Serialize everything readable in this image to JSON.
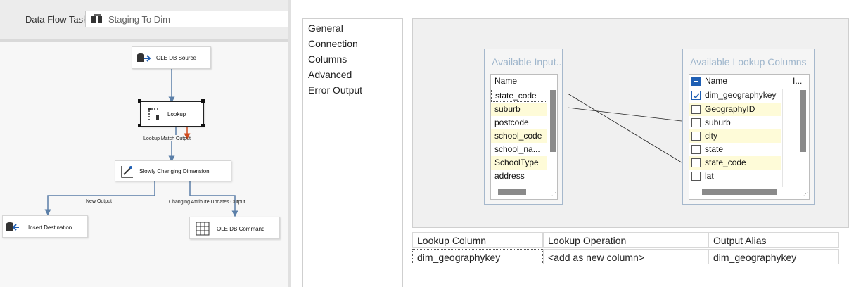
{
  "designer": {
    "task_label": "Data Flow Task:",
    "task_value": "Staging To Dim",
    "nodes": {
      "ole_db_source": "OLE DB Source",
      "lookup": "Lookup",
      "scd": "Slowly Changing Dimension",
      "insert_destination": "Insert Destination",
      "ole_db_command": "OLE DB Command"
    },
    "paths": {
      "lookup_match": "Lookup Match Output",
      "new_output": "New Output",
      "changing_attribute": "Changing Attribute Updates Output"
    }
  },
  "pages": [
    "General",
    "Connection",
    "Columns",
    "Advanced",
    "Error Output"
  ],
  "available_input": {
    "title": "Available Input...",
    "header": "Name",
    "rows": [
      {
        "name": "state_code",
        "highlight": false
      },
      {
        "name": "suburb",
        "highlight": true
      },
      {
        "name": "postcode",
        "highlight": false
      },
      {
        "name": "school_code",
        "highlight": true
      },
      {
        "name": "school_na...",
        "highlight": false
      },
      {
        "name": "SchoolType",
        "highlight": true
      },
      {
        "name": "address",
        "highlight": false
      }
    ]
  },
  "available_lookup": {
    "title": "Available Lookup Columns",
    "header": "Name",
    "header2": "I...",
    "rows": [
      {
        "name": "dim_geographykey",
        "checked": true,
        "highlight": false
      },
      {
        "name": "GeographyID",
        "checked": false,
        "highlight": true
      },
      {
        "name": "suburb",
        "checked": false,
        "highlight": false
      },
      {
        "name": "city",
        "checked": false,
        "highlight": true
      },
      {
        "name": "state",
        "checked": false,
        "highlight": false
      },
      {
        "name": "state_code",
        "checked": false,
        "highlight": true
      },
      {
        "name": "lat",
        "checked": false,
        "highlight": false
      }
    ]
  },
  "grid": {
    "headers": [
      "Lookup Column",
      "Lookup Operation",
      "Output Alias"
    ],
    "rows": [
      [
        "dim_geographykey",
        "<add as new column>",
        "dim_geographykey"
      ]
    ]
  },
  "colors": {
    "accent": "#1f5fb4",
    "highlight_row": "#fefbd8",
    "flow_arrow": "#5b7fa8",
    "error_arrow": "#d04a1c"
  }
}
